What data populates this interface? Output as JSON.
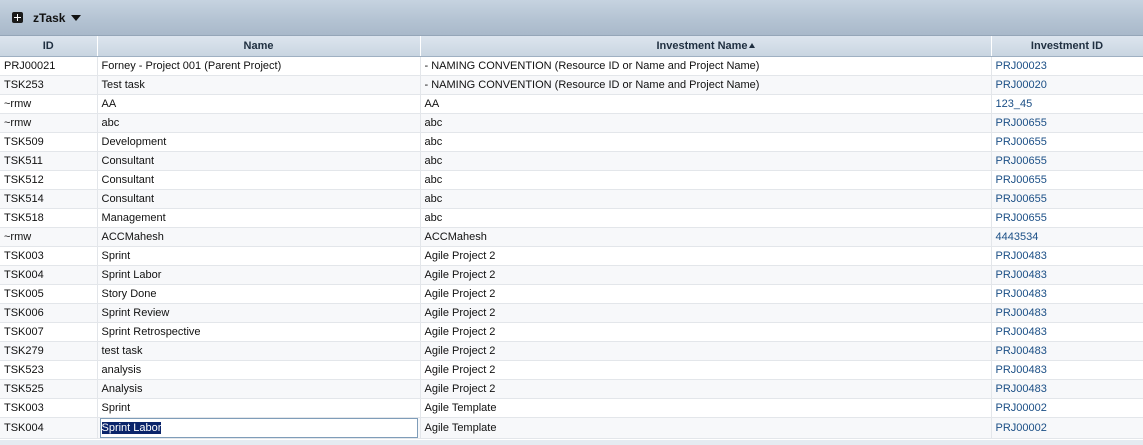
{
  "portlet": {
    "title": "zTask"
  },
  "columns": {
    "id": "ID",
    "name": "Name",
    "investment_name": "Investment Name",
    "investment_id": "Investment ID"
  },
  "rows": [
    {
      "id": "PRJ00021",
      "name": "Forney - Project 001 (Parent Project)",
      "investment_name": "- NAMING CONVENTION (Resource ID or Name and Project Name)",
      "investment_id": "PRJ00023"
    },
    {
      "id": "TSK253",
      "name": "Test task",
      "investment_name": "- NAMING CONVENTION (Resource ID or Name and Project Name)",
      "investment_id": "PRJ00020"
    },
    {
      "id": "~rmw",
      "name": "AA",
      "investment_name": "AA",
      "investment_id": "123_45"
    },
    {
      "id": "~rmw",
      "name": "abc",
      "investment_name": "abc",
      "investment_id": "PRJ00655"
    },
    {
      "id": "TSK509",
      "name": "Development",
      "investment_name": "abc",
      "investment_id": "PRJ00655"
    },
    {
      "id": "TSK511",
      "name": "Consultant",
      "investment_name": "abc",
      "investment_id": "PRJ00655"
    },
    {
      "id": "TSK512",
      "name": "Consultant",
      "investment_name": "abc",
      "investment_id": "PRJ00655"
    },
    {
      "id": "TSK514",
      "name": "Consultant",
      "investment_name": "abc",
      "investment_id": "PRJ00655"
    },
    {
      "id": "TSK518",
      "name": "Management",
      "investment_name": "abc",
      "investment_id": "PRJ00655"
    },
    {
      "id": "~rmw",
      "name": "ACCMahesh",
      "investment_name": "ACCMahesh",
      "investment_id": "4443534"
    },
    {
      "id": "TSK003",
      "name": "Sprint",
      "investment_name": "Agile Project 2",
      "investment_id": "PRJ00483"
    },
    {
      "id": "TSK004",
      "name": "Sprint Labor",
      "investment_name": "Agile Project 2",
      "investment_id": "PRJ00483"
    },
    {
      "id": "TSK005",
      "name": "Story Done",
      "investment_name": "Agile Project 2",
      "investment_id": "PRJ00483"
    },
    {
      "id": "TSK006",
      "name": "Sprint Review",
      "investment_name": "Agile Project 2",
      "investment_id": "PRJ00483"
    },
    {
      "id": "TSK007",
      "name": "Sprint Retrospective",
      "investment_name": "Agile Project 2",
      "investment_id": "PRJ00483"
    },
    {
      "id": "TSK279",
      "name": "test task",
      "investment_name": "Agile Project 2",
      "investment_id": "PRJ00483"
    },
    {
      "id": "TSK523",
      "name": "analysis",
      "investment_name": "Agile Project 2",
      "investment_id": "PRJ00483"
    },
    {
      "id": "TSK525",
      "name": "Analysis",
      "investment_name": "Agile Project 2",
      "investment_id": "PRJ00483"
    },
    {
      "id": "TSK003",
      "name": "Sprint",
      "investment_name": "Agile Template",
      "investment_id": "PRJ00002"
    },
    {
      "id": "TSK004",
      "name": "Sprint Labor",
      "investment_name": "Agile Template",
      "investment_id": "PRJ00002"
    }
  ],
  "editing_row_index": 19,
  "sort": {
    "column": "investment_name",
    "direction": "ascending"
  },
  "colors": {
    "titlebar": "#b3c2d2",
    "header": "#c9d5e1",
    "link": "#1b4f86",
    "selection": "#0a246a"
  },
  "icons": {
    "expand": "expand-plus-icon",
    "menu": "caret-down-icon",
    "sort": "sort-ascending-icon"
  }
}
